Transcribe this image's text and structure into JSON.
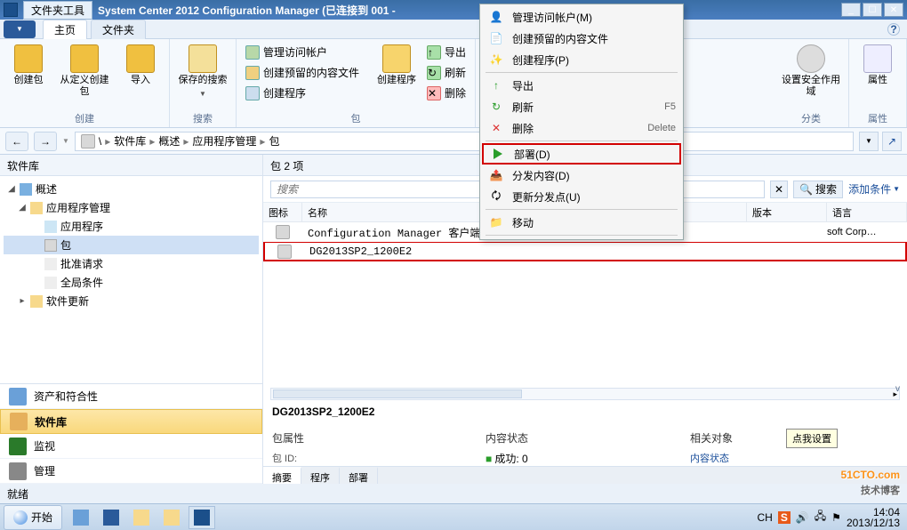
{
  "title": {
    "tool_tab": "文件夹工具",
    "text": "System Center 2012 Configuration Manager (已连接到 001 -"
  },
  "ribbon": {
    "tabs": {
      "home": "主页",
      "folder": "文件夹"
    },
    "groups": {
      "create": {
        "label": "创建",
        "btn1": "创建包",
        "btn2": "从定义创建包",
        "btn3": "导入"
      },
      "search": {
        "label": "搜索",
        "btn": "保存的搜索"
      },
      "package": {
        "label": "包",
        "a1": "管理访问帐户",
        "a2": "创建预留的内容文件",
        "a3": "创建程序",
        "b1": "导出",
        "b2": "刷新",
        "b3": "删除",
        "main": "创建程序"
      },
      "classify": {
        "label": "分类",
        "btn": "设置安全作用域"
      },
      "properties": {
        "label": "属性",
        "btn": "属性"
      }
    }
  },
  "breadcrumb": {
    "p1": "软件库",
    "p2": "概述",
    "p3": "应用程序管理",
    "p4": "包"
  },
  "sidebar": {
    "head": "软件库",
    "nodes": {
      "overview": "概述",
      "appmgmt": "应用程序管理",
      "apps": "应用程序",
      "pkg": "包",
      "approve": "批准请求",
      "global": "全局条件",
      "update": "软件更新"
    },
    "wunder": {
      "asset": "资产和符合性",
      "lib": "软件库",
      "monitor": "监视",
      "manage": "管理"
    }
  },
  "content": {
    "head": "包 2 项",
    "search_placeholder": "搜索",
    "search_btn": "搜索",
    "add_cond": "添加条件",
    "columns": {
      "icon": "图标",
      "name": "名称",
      "ver": "版本",
      "lang": "语言"
    },
    "rows": [
      {
        "name": "Configuration Manager 客户端包",
        "mfr": "soft Corp…"
      },
      {
        "name": "DG2013SP2_1200E2",
        "mfr": ""
      }
    ],
    "detail": {
      "title": "DG2013SP2_1200E2",
      "c1": "包属性",
      "c2": "内容状态",
      "c3": "相关对象",
      "pkgid_lbl": "包 ID:",
      "c2b": "成功: 0",
      "c3b": "内容状态",
      "tabs": {
        "t1": "摘要",
        "t2": "程序",
        "t3": "部署"
      }
    }
  },
  "context": {
    "i1": "管理访问帐户(M)",
    "i2": "创建预留的内容文件",
    "i3": "创建程序(P)",
    "i4": "导出",
    "i5": "刷新",
    "i5k": "F5",
    "i6": "删除",
    "i6k": "Delete",
    "i7": "部署(D)",
    "i8": "分发内容(D)",
    "i9": "更新分发点(U)",
    "i10": "移动"
  },
  "tooltip": "点我设置",
  "status": "就绪",
  "taskbar": {
    "start": "开始",
    "ime": "CH",
    "time": "14:04",
    "date": "2013/12/13"
  },
  "watermark": {
    "site": "51CTO.com",
    "sub": "技术博客"
  }
}
